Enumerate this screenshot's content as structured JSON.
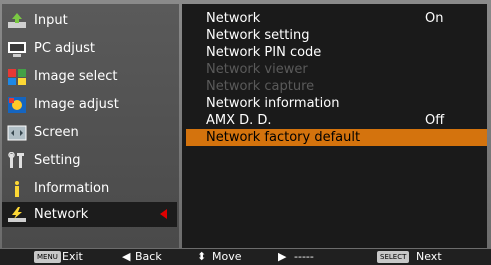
{
  "menu": {
    "items": [
      {
        "label": "Input",
        "icon": "input-icon"
      },
      {
        "label": "PC adjust",
        "icon": "pc-adjust-icon"
      },
      {
        "label": "Image select",
        "icon": "image-select-icon"
      },
      {
        "label": "Image adjust",
        "icon": "image-adjust-icon"
      },
      {
        "label": "Screen",
        "icon": "screen-icon"
      },
      {
        "label": "Setting",
        "icon": "setting-icon"
      },
      {
        "label": "Information",
        "icon": "information-icon"
      },
      {
        "label": "Network",
        "icon": "network-icon"
      }
    ],
    "selected": "Network"
  },
  "submenu": {
    "rows": [
      {
        "label": "Network",
        "value": "On"
      },
      {
        "label": "Network setting",
        "value": ""
      },
      {
        "label": "Network PIN code",
        "value": ""
      },
      {
        "label": "Network viewer",
        "value": ""
      },
      {
        "label": "Network capture",
        "value": ""
      },
      {
        "label": "Network information",
        "value": ""
      },
      {
        "label": "AMX D. D.",
        "value": "Off"
      },
      {
        "label": "Network factory default",
        "value": ""
      }
    ]
  },
  "footer": {
    "menu_key": "MENU",
    "exit_label": "Exit",
    "back_arrow": "◀",
    "back_label": "Back",
    "move_arrows": "⬍",
    "move_label": "Move",
    "next_arrow": "▶",
    "dashes": "-----",
    "select_key": "SELECT",
    "next_label": "Next"
  },
  "colors": {
    "highlight": "#d4730d",
    "selection_marker": "#e00000"
  }
}
